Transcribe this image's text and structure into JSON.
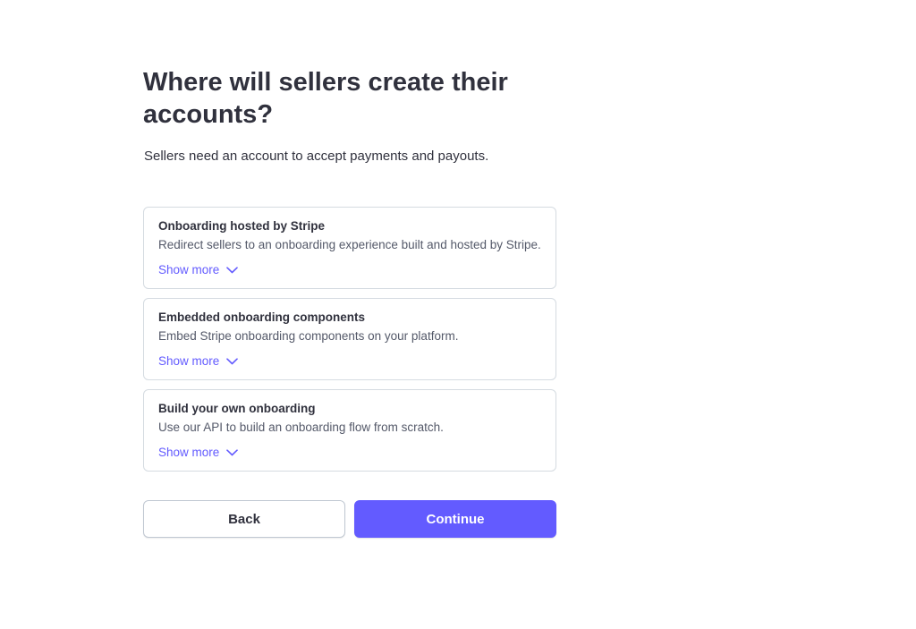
{
  "heading": {
    "title": "Where will sellers create their accounts?",
    "subtitle": "Sellers need an account to accept payments and payouts."
  },
  "options": [
    {
      "title": "Onboarding hosted by Stripe",
      "description": "Redirect sellers to an onboarding experience built and hosted by Stripe.",
      "show_more": "Show more",
      "icon": "chevron-down-icon"
    },
    {
      "title": "Embedded onboarding components",
      "description": "Embed Stripe onboarding components on your platform.",
      "show_more": "Show more",
      "icon": "chevron-down-icon"
    },
    {
      "title": "Build your own onboarding",
      "description": "Use our API to build an onboarding flow from scratch.",
      "show_more": "Show more",
      "icon": "chevron-down-icon"
    }
  ],
  "buttons": {
    "back_label": "Back",
    "continue_label": "Continue"
  },
  "colors": {
    "accent": "#635bff",
    "text": "#30313d",
    "muted_text": "#545969",
    "border": "#d5dbe1"
  }
}
